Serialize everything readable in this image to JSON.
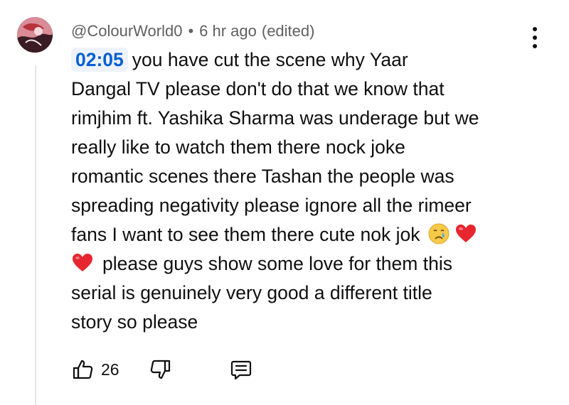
{
  "comment": {
    "author": "@ColourWorld0",
    "separator": "•",
    "time": "6 hr ago",
    "edited": "(edited)",
    "timestamp_link": "02:05",
    "lines": {
      "l1": "you have cut  the scene why Yaar",
      "l2": "Dangal TV please don't do that we know that",
      "l3": "rimjhim ft. Yashika Sharma was underage but we",
      "l4": "really like to watch them there nock joke",
      "l5": "romantic scenes there Tashan the people was",
      "l6": "spreading negativity please ignore all the rimeer",
      "l7": "fans I want to see them there cute nok jok",
      "l8": "please guys show some love for  them  this",
      "l9": "serial is genuinely very good a different title",
      "l10": "story so please"
    },
    "emojis": [
      "crying-face-emoji",
      "red-heart-emoji",
      "red-heart-emoji"
    ]
  },
  "actions": {
    "like_count": "26",
    "icons": [
      "thumbs-up-icon",
      "thumbs-down-icon",
      "reply-icon",
      "more-vert-icon"
    ]
  },
  "colors": {
    "link_blue": "#065fd4",
    "meta_gray": "#606060",
    "text": "#0f0f0f",
    "heart_red": "#e8262f"
  }
}
